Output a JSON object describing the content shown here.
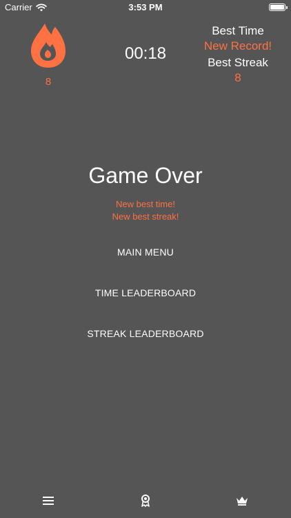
{
  "status_bar": {
    "carrier": "Carrier",
    "time": "3:53 PM"
  },
  "header": {
    "streak_count": "8",
    "timer": "00:18",
    "best_time_label": "Best Time",
    "best_time_value": "New Record!",
    "best_streak_label": "Best Streak",
    "best_streak_value": "8"
  },
  "main": {
    "title": "Game Over",
    "messages": [
      "New best time!",
      "New best streak!"
    ],
    "buttons": {
      "main_menu": "MAIN MENU",
      "time_leaderboard": "TIME LEADERBOARD",
      "streak_leaderboard": "STREAK LEADERBOARD"
    }
  },
  "tab_bar": {
    "icons": [
      "menu-icon",
      "award-ribbon-icon",
      "crown-icon"
    ]
  },
  "colors": {
    "background": "#555555",
    "accent": "#ff7043",
    "text": "#ffffff"
  }
}
